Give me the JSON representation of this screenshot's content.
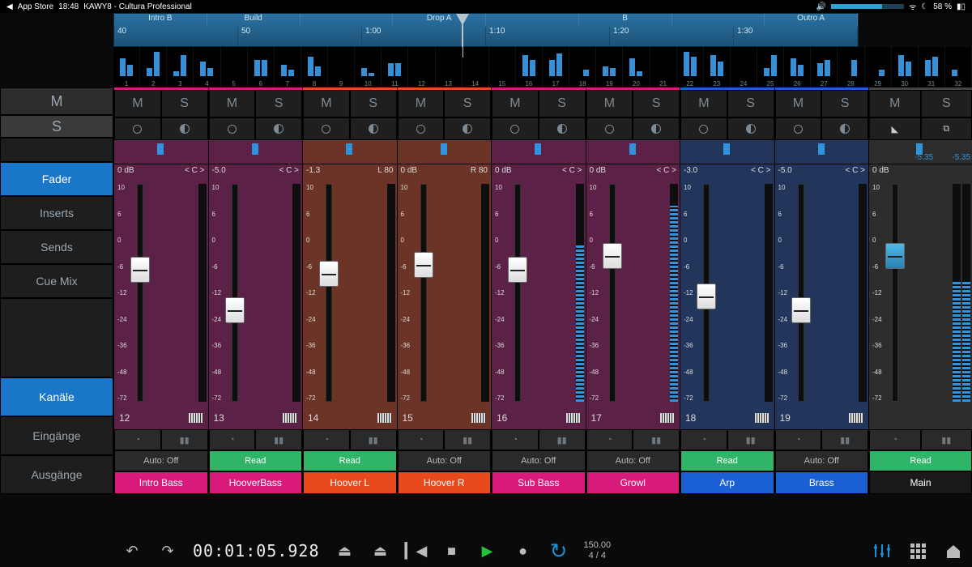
{
  "status": {
    "back": "App Store",
    "time": "18:48",
    "app": "KAWY8 - Cultura Professional",
    "battery": "58 %"
  },
  "timeline": {
    "sections": [
      "Intro B",
      "Build",
      "",
      "Drop A",
      "",
      "B",
      "",
      "Outro A"
    ],
    "ticks": [
      "40",
      "50",
      "1:00",
      "1:10",
      "1:20",
      "1:30"
    ]
  },
  "mini": {
    "count": 32,
    "heights": [
      [
        22,
        14
      ],
      [
        10,
        30
      ],
      [
        6,
        26
      ],
      [
        18,
        10
      ],
      [
        0,
        0
      ],
      [
        20,
        20
      ],
      [
        14,
        8
      ],
      [
        24,
        12
      ],
      [
        0,
        0
      ],
      [
        10,
        4
      ],
      [
        16,
        16
      ],
      [
        0,
        0
      ],
      [
        0,
        0
      ],
      [
        0,
        0
      ],
      [
        0,
        0
      ],
      [
        26,
        20
      ],
      [
        20,
        28
      ],
      [
        0,
        8
      ],
      [
        12,
        10
      ],
      [
        22,
        6
      ],
      [
        0,
        0
      ],
      [
        30,
        24
      ],
      [
        26,
        18
      ],
      [
        0,
        0
      ],
      [
        10,
        26
      ],
      [
        22,
        14
      ],
      [
        16,
        20
      ],
      [
        0,
        20
      ],
      [
        0,
        8
      ],
      [
        26,
        18
      ],
      [
        20,
        24
      ],
      [
        8,
        0
      ]
    ]
  },
  "left": {
    "m": "M",
    "s": "S",
    "fader": "Fader",
    "inserts": "Inserts",
    "sends": "Sends",
    "cue": "Cue Mix",
    "kanale": "Kanäle",
    "eingange": "Eingänge",
    "ausgange": "Ausgänge"
  },
  "scale": [
    "10",
    "6",
    "0",
    "-6",
    "-12",
    "-24",
    "-36",
    "-48",
    "-72"
  ],
  "channels": [
    {
      "db": "0 dB",
      "pan": "< C >",
      "knob": 34,
      "num": "12",
      "auto": "off",
      "name": "Intro Bass",
      "bg": "purple",
      "tb": "mag",
      "nm": "magenta",
      "meter": 0
    },
    {
      "db": "-5.0",
      "pan": "< C >",
      "knob": 52,
      "num": "13",
      "auto": "read",
      "name": "HooverBass",
      "bg": "purple",
      "tb": "mag",
      "nm": "magenta",
      "meter": 0
    },
    {
      "db": "-1.3",
      "pan": "L 80",
      "knob": 36,
      "num": "14",
      "auto": "read",
      "name": "Hoover L",
      "bg": "brown",
      "tb": "or",
      "nm": "orange",
      "meter": 0
    },
    {
      "db": "0 dB",
      "pan": "R 80",
      "knob": 32,
      "num": "15",
      "auto": "off",
      "name": "Hoover R",
      "bg": "brown",
      "tb": "or",
      "nm": "orange",
      "meter": 0
    },
    {
      "db": "0 dB",
      "pan": "< C >",
      "knob": 34,
      "num": "16",
      "auto": "off",
      "name": "Sub Bass",
      "bg": "purple",
      "tb": "mag",
      "nm": "magenta",
      "meter": 72
    },
    {
      "db": "0 dB",
      "pan": "< C >",
      "knob": 28,
      "num": "17",
      "auto": "off",
      "name": "Growl",
      "bg": "purple",
      "tb": "mag",
      "nm": "magenta",
      "meter": 90
    },
    {
      "db": "-3.0",
      "pan": "< C >",
      "knob": 46,
      "num": "18",
      "auto": "read",
      "name": "Arp",
      "bg": "darkblue",
      "tb": "bl",
      "nm": "blue",
      "meter": 0
    },
    {
      "db": "-5.0",
      "pan": "< C >",
      "knob": 52,
      "num": "19",
      "auto": "off",
      "name": "Brass",
      "bg": "darkblue",
      "tb": "bl",
      "nm": "blue",
      "meter": 0
    }
  ],
  "main_ch": {
    "db": "0 dB",
    "clip": "-5.35",
    "auto": "read",
    "name": "Main",
    "knob": 28,
    "meter": 55
  },
  "auto_labels": {
    "off": "Auto: Off",
    "read": "Read"
  },
  "transport": {
    "tc": "00:01:05.928",
    "tempo": "150.00",
    "bars": "4 / 4"
  }
}
